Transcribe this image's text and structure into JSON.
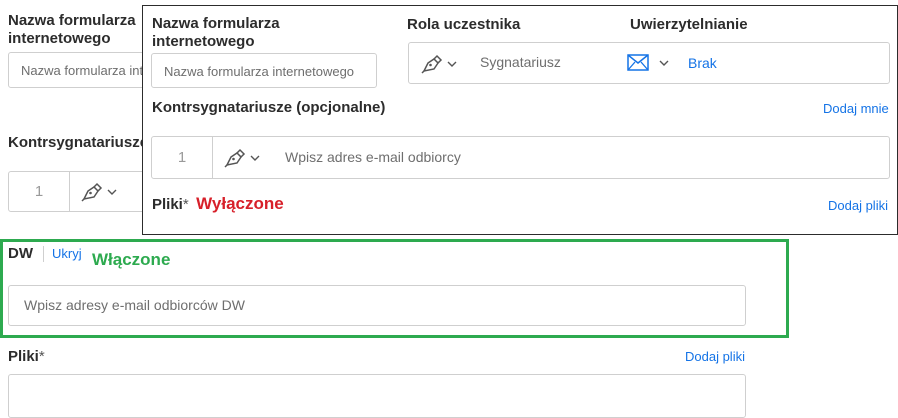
{
  "background_form": {
    "form_name_label": "Nazwa formularza internetowego",
    "form_name_placeholder": "Nazwa formularza internetowego",
    "cosigners_label": "Kontrsygnatariusze",
    "cosigner_index": "1",
    "cc_label": "DW",
    "cc_hide_link": "Ukryj",
    "cc_placeholder": "Wpisz adresy e-mail odbiorców DW",
    "files_label": "Pliki",
    "files_required_mark": "*",
    "add_files_link": "Dodaj pliki"
  },
  "overlay": {
    "form_name_label": "Nazwa formularza internetowego",
    "form_name_placeholder": "Nazwa formularza internetowego",
    "role_label": "Rola uczestnika",
    "role_value": "Sygnatariusz",
    "auth_label": "Uwierzytelnianie",
    "auth_value": "Brak",
    "cosigners_label": "Kontrsygnatariusze (opcjonalne)",
    "add_me_link": "Dodaj mnie",
    "cosigner_index": "1",
    "email_placeholder": "Wpisz adres e-mail odbiorcy",
    "files_label": "Pliki",
    "files_required_mark": "*",
    "files_status": "Wyłączone",
    "add_files_link": "Dodaj pliki"
  },
  "annotations": {
    "enabled_text": "Włączone"
  },
  "colors": {
    "link": "#1473e6",
    "disabled_annotation": "#d7202a",
    "enabled_annotation": "#2daa4f"
  }
}
